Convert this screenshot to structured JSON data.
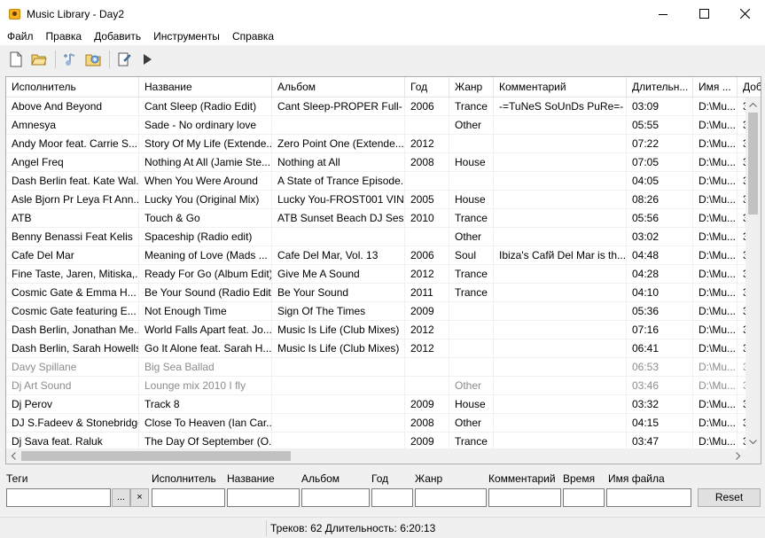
{
  "window": {
    "title": "Music Library - Day2"
  },
  "menu": [
    "Файл",
    "Правка",
    "Добавить",
    "Инструменты",
    "Справка"
  ],
  "toolbar": {
    "icons": [
      "new-file-icon",
      "open-folder-icon",
      "add-track-icon",
      "add-folder-icon",
      "edit-tags-icon",
      "play-icon"
    ]
  },
  "table": {
    "columns": [
      "Исполнитель",
      "Название",
      "Альбом",
      "Год",
      "Жанр",
      "Комментарий",
      "Длительн...",
      "Имя ...",
      "Доб"
    ],
    "rows": [
      {
        "dim": false,
        "cells": [
          "Above And Beyond",
          "Cant Sleep (Radio Edit)",
          "Cant Sleep-PROPER Full-",
          "2006",
          "Trance",
          "-=TuNeS SoUnDs PuRe=-",
          "03:09",
          "D:\\Mu...",
          "3:"
        ]
      },
      {
        "dim": false,
        "cells": [
          "Amnesya",
          "Sade - No ordinary love",
          "",
          "",
          "Other",
          "",
          "05:55",
          "D:\\Mu...",
          "3:"
        ]
      },
      {
        "dim": false,
        "cells": [
          "Andy Moor feat. Carrie S...",
          "Story Of My Life (Extende...",
          "Zero Point One (Extende...",
          "2012",
          "",
          "",
          "07:22",
          "D:\\Mu...",
          "3:"
        ]
      },
      {
        "dim": false,
        "cells": [
          "Angel Freq",
          "Nothing At All (Jamie Ste...",
          "Nothing at All",
          "2008",
          "House",
          "",
          "07:05",
          "D:\\Mu...",
          "3:"
        ]
      },
      {
        "dim": false,
        "cells": [
          "Dash Berlin feat. Kate Wal...",
          "When You Were Around",
          "A State of Trance Episode...",
          "",
          "",
          "",
          "04:05",
          "D:\\Mu...",
          "3:"
        ]
      },
      {
        "dim": false,
        "cells": [
          "Asle Bjorn Pr Leya Ft Ann...",
          "Lucky You (Original Mix)",
          "Lucky You-FROST001 VIN...",
          "2005",
          "House",
          "",
          "08:26",
          "D:\\Mu...",
          "3:"
        ]
      },
      {
        "dim": false,
        "cells": [
          "ATB",
          "Touch & Go",
          "ATB Sunset Beach DJ Sess...",
          "2010",
          "Trance",
          "",
          "05:56",
          "D:\\Mu...",
          "3:"
        ]
      },
      {
        "dim": false,
        "cells": [
          "Benny Benassi Feat Kelis",
          "Spaceship (Radio edit)",
          "",
          "",
          "Other",
          "",
          "03:02",
          "D:\\Mu...",
          "3:"
        ]
      },
      {
        "dim": false,
        "cells": [
          "Cafe Del Mar",
          "Meaning of Love (Mads ...",
          "Cafe Del Mar, Vol. 13",
          "2006",
          "Soul",
          "Ibiza's Cafй Del Mar is th...",
          "04:48",
          "D:\\Mu...",
          "3:"
        ]
      },
      {
        "dim": false,
        "cells": [
          "Fine Taste, Jaren, Mitiska,...",
          "Ready For Go (Album Edit)",
          "Give Me A Sound",
          "2012",
          "Trance",
          "",
          "04:28",
          "D:\\Mu...",
          "3:"
        ]
      },
      {
        "dim": false,
        "cells": [
          "Cosmic Gate & Emma H...",
          "Be Your Sound (Radio Edit)",
          "Be Your Sound",
          "2011",
          "Trance",
          "",
          "04:10",
          "D:\\Mu...",
          "3:"
        ]
      },
      {
        "dim": false,
        "cells": [
          "Cosmic Gate featuring E...",
          "Not Enough Time",
          "Sign Of The Times",
          "2009",
          "",
          "",
          "05:36",
          "D:\\Mu...",
          "3:"
        ]
      },
      {
        "dim": false,
        "cells": [
          "Dash Berlin, Jonathan Me...",
          "World Falls Apart feat. Jo...",
          "Music Is Life (Club Mixes)",
          "2012",
          "",
          "",
          "07:16",
          "D:\\Mu...",
          "3:"
        ]
      },
      {
        "dim": false,
        "cells": [
          "Dash Berlin, Sarah Howells",
          "Go It Alone feat. Sarah H...",
          "Music Is Life (Club Mixes)",
          "2012",
          "",
          "",
          "06:41",
          "D:\\Mu...",
          "3:"
        ]
      },
      {
        "dim": true,
        "cells": [
          "Davy Spillane",
          "Big Sea Ballad",
          "",
          "",
          "",
          "",
          "06:53",
          "D:\\Mu...",
          "3:"
        ]
      },
      {
        "dim": true,
        "cells": [
          "Dj Art Sound",
          "Lounge mix 2010 I fly",
          "",
          "",
          "Other",
          "",
          "03:46",
          "D:\\Mu...",
          "3:"
        ]
      },
      {
        "dim": false,
        "cells": [
          "Dj Perov",
          "Track 8",
          "",
          "2009",
          "House",
          "",
          "03:32",
          "D:\\Mu...",
          "3:"
        ]
      },
      {
        "dim": false,
        "cells": [
          "DJ S.Fadeev & Stonebridge",
          "Close To Heaven (Ian Car...",
          "",
          "2008",
          "Other",
          "",
          "04:15",
          "D:\\Mu...",
          "3:"
        ]
      },
      {
        "dim": false,
        "cells": [
          "Dj Sava feat. Raluk",
          "The Day Of September (O...",
          "",
          "2009",
          "Trance",
          "",
          "03:47",
          "D:\\Mu...",
          "3:"
        ]
      }
    ]
  },
  "filters": {
    "labels": {
      "tags": "Теги",
      "artist": "Исполнитель",
      "title": "Название",
      "album": "Альбом",
      "year": "Год",
      "genre": "Жанр",
      "comment": "Комментарий",
      "time": "Время",
      "filename": "Имя файла"
    },
    "browse_label": "...",
    "clear_label": "×",
    "reset_label": "Reset"
  },
  "status": {
    "text": "Треков: 62 Длительность: 6:20:13"
  }
}
